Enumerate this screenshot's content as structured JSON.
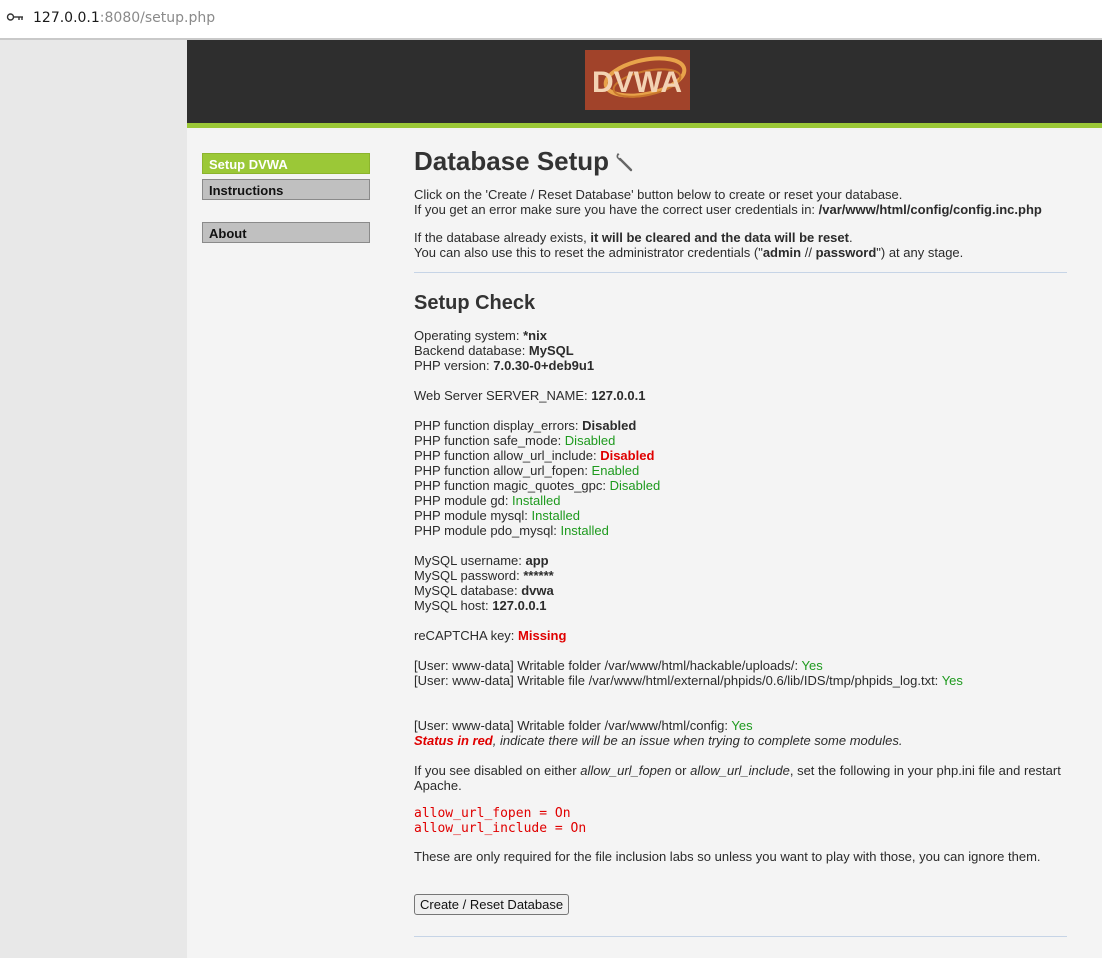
{
  "browser": {
    "url_host": "127.0.0.1",
    "url_rest": ":8080/setup.php"
  },
  "header": {
    "logo_text": "DVWA"
  },
  "sidebar": {
    "items": [
      {
        "label": "Setup DVWA"
      },
      {
        "label": "Instructions"
      },
      {
        "label": "About"
      }
    ]
  },
  "main": {
    "title": "Database Setup",
    "intro1": "Click on the 'Create / Reset Database' button below to create or reset your database.",
    "intro2_prefix": "If you get an error make sure you have the correct user credentials in: ",
    "intro2_path": "/var/www/html/config/config.inc.php",
    "intro3_prefix": "If the database already exists, ",
    "intro3_bold": "it will be cleared and the data will be reset",
    "intro3_suffix": ".",
    "intro4_prefix": "You can also use this to reset the administrator credentials (\"",
    "intro4_user": "admin",
    "intro4_sep": " // ",
    "intro4_pass": "password",
    "intro4_suffix": "\") at any stage.",
    "check_title": "Setup Check",
    "os_label": "Operating system: ",
    "os_value": "*nix",
    "db_label": "Backend database: ",
    "db_value": "MySQL",
    "php_label": "PHP version: ",
    "php_value": "7.0.30-0+deb9u1",
    "server_label": "Web Server SERVER_NAME: ",
    "server_value": "127.0.0.1",
    "funcs": [
      {
        "label": "PHP function display_errors: ",
        "value": "Disabled"
      },
      {
        "label": "PHP function safe_mode: ",
        "value": "Disabled"
      },
      {
        "label": "PHP function allow_url_include: ",
        "value": "Disabled"
      },
      {
        "label": "PHP function allow_url_fopen: ",
        "value": "Enabled"
      },
      {
        "label": "PHP function magic_quotes_gpc: ",
        "value": "Disabled"
      },
      {
        "label": "PHP module gd: ",
        "value": "Installed"
      },
      {
        "label": "PHP module mysql: ",
        "value": "Installed"
      },
      {
        "label": "PHP module pdo_mysql: ",
        "value": "Installed"
      }
    ],
    "mysql": [
      {
        "label": "MySQL username: ",
        "value": "app"
      },
      {
        "label": "MySQL password: ",
        "value": "******"
      },
      {
        "label": "MySQL database: ",
        "value": "dvwa"
      },
      {
        "label": "MySQL host: ",
        "value": "127.0.0.1"
      }
    ],
    "recaptcha_label": "reCAPTCHA key: ",
    "recaptcha_value": "Missing",
    "writable1_label": "[User: www-data] Writable folder /var/www/html/hackable/uploads/: ",
    "writable1_value": "Yes",
    "writable2_label": "[User: www-data] Writable file /var/www/html/external/phpids/0.6/lib/IDS/tmp/phpids_log.txt: ",
    "writable2_value": "Yes",
    "writable3_label": "[User: www-data] Writable folder /var/www/html/config: ",
    "writable3_value": "Yes",
    "status_red": "Status in red",
    "status_rest": ", indicate there will be an issue when trying to complete some modules.",
    "disabled_p1": "If you see disabled on either ",
    "disabled_fopen": "allow_url_fopen",
    "disabled_or": " or ",
    "disabled_include": "allow_url_include",
    "disabled_p2": ", set the following in your php.ini file and restart",
    "disabled_p3": "Apache.",
    "code1": "allow_url_fopen = On",
    "code2": "allow_url_include = On",
    "only_required": "These are only required for the file inclusion labs so unless you want to play with those, you can ignore them.",
    "button_label": "Create / Reset Database"
  },
  "colors": {
    "accent": "#9bc837",
    "ok": "#1e9a1e",
    "error": "#e00000",
    "header_bg": "#2e2e2e"
  },
  "icons": [
    "key-icon",
    "wrench-icon"
  ]
}
